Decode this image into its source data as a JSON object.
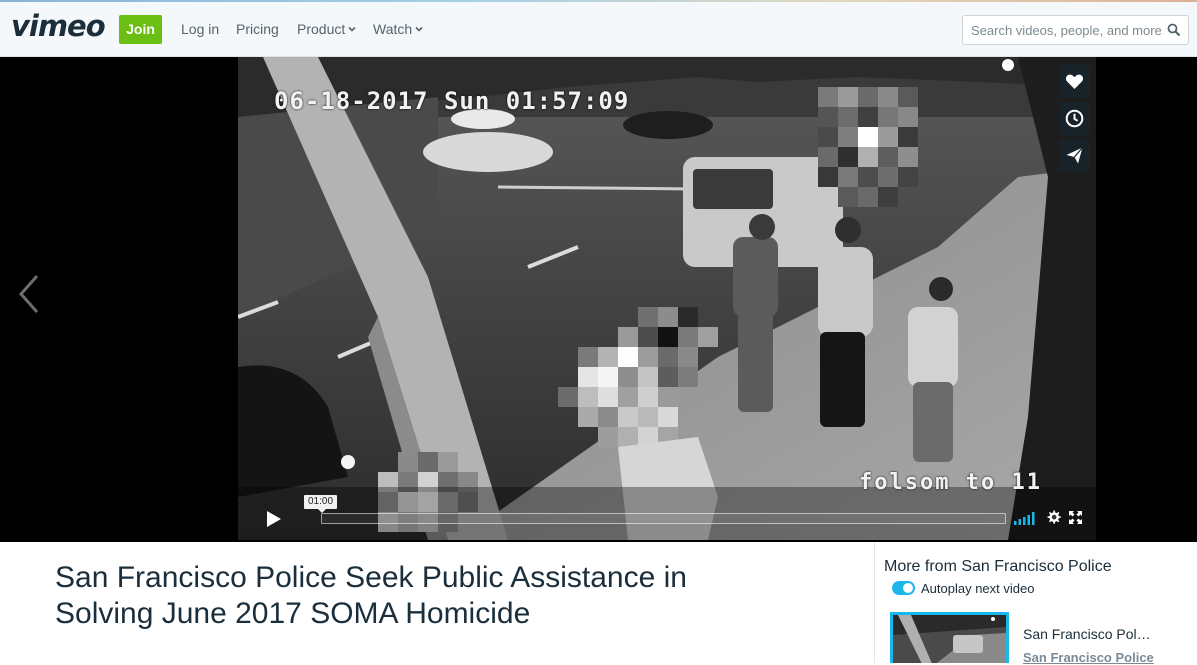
{
  "header": {
    "logo": "vimeo",
    "join_label": "Join",
    "login_label": "Log in",
    "pricing_label": "Pricing",
    "product_label": "Product",
    "watch_label": "Watch",
    "search_placeholder": "Search videos, people, and more"
  },
  "player": {
    "osd_timestamp": "06-18-2017 Sun 01:57:09",
    "osd_camera": "folsom to 11",
    "tooltip_time": "01:00",
    "progress": 0,
    "side_icons": [
      "heart-icon",
      "clock-icon",
      "send-icon"
    ],
    "control_icons": [
      "play-icon",
      "volume-icon",
      "gear-icon",
      "fullscreen-icon"
    ],
    "accent_color": "#1ab7ea"
  },
  "video": {
    "title": "San Francisco Police Seek Public Assistance in Solving June 2017 SOMA Homicide"
  },
  "sidebar": {
    "heading": "More from San Francisco Police",
    "autoplay_label": "Autoplay next video",
    "autoplay_on": true,
    "next_video": {
      "title": "San Francisco Pol…",
      "owner": "San Francisco Police"
    }
  },
  "colors": {
    "join_green": "#6bbf14",
    "text_dark": "#1a2e3b",
    "accent_blue": "#1ab7ea"
  }
}
